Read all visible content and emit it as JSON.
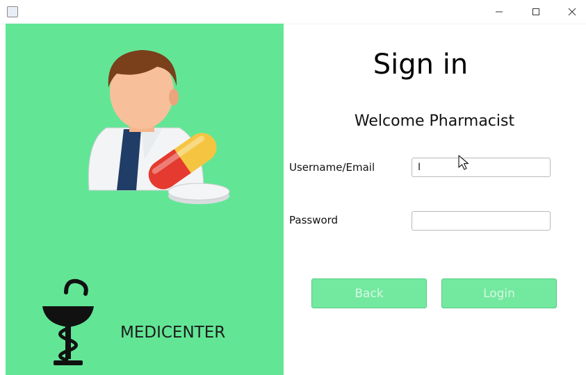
{
  "window": {
    "icon": "java-app-icon",
    "controls": [
      "minimize-icon",
      "maximize-icon",
      "close-icon"
    ]
  },
  "left_panel": {
    "background_color": "#62e695",
    "illustration_icon": "pharmacist-icon",
    "logo_icon": "bowl-of-hygieia-icon",
    "brand_name": "MEDICENTER"
  },
  "form": {
    "title": "Sign in",
    "subtitle": "Welcome Pharmacist",
    "username_label": "Username/Email",
    "username_value": "I",
    "password_label": "Password",
    "password_value": "",
    "back_label": "Back",
    "login_label": "Login",
    "button_color": "#73e9a0"
  }
}
